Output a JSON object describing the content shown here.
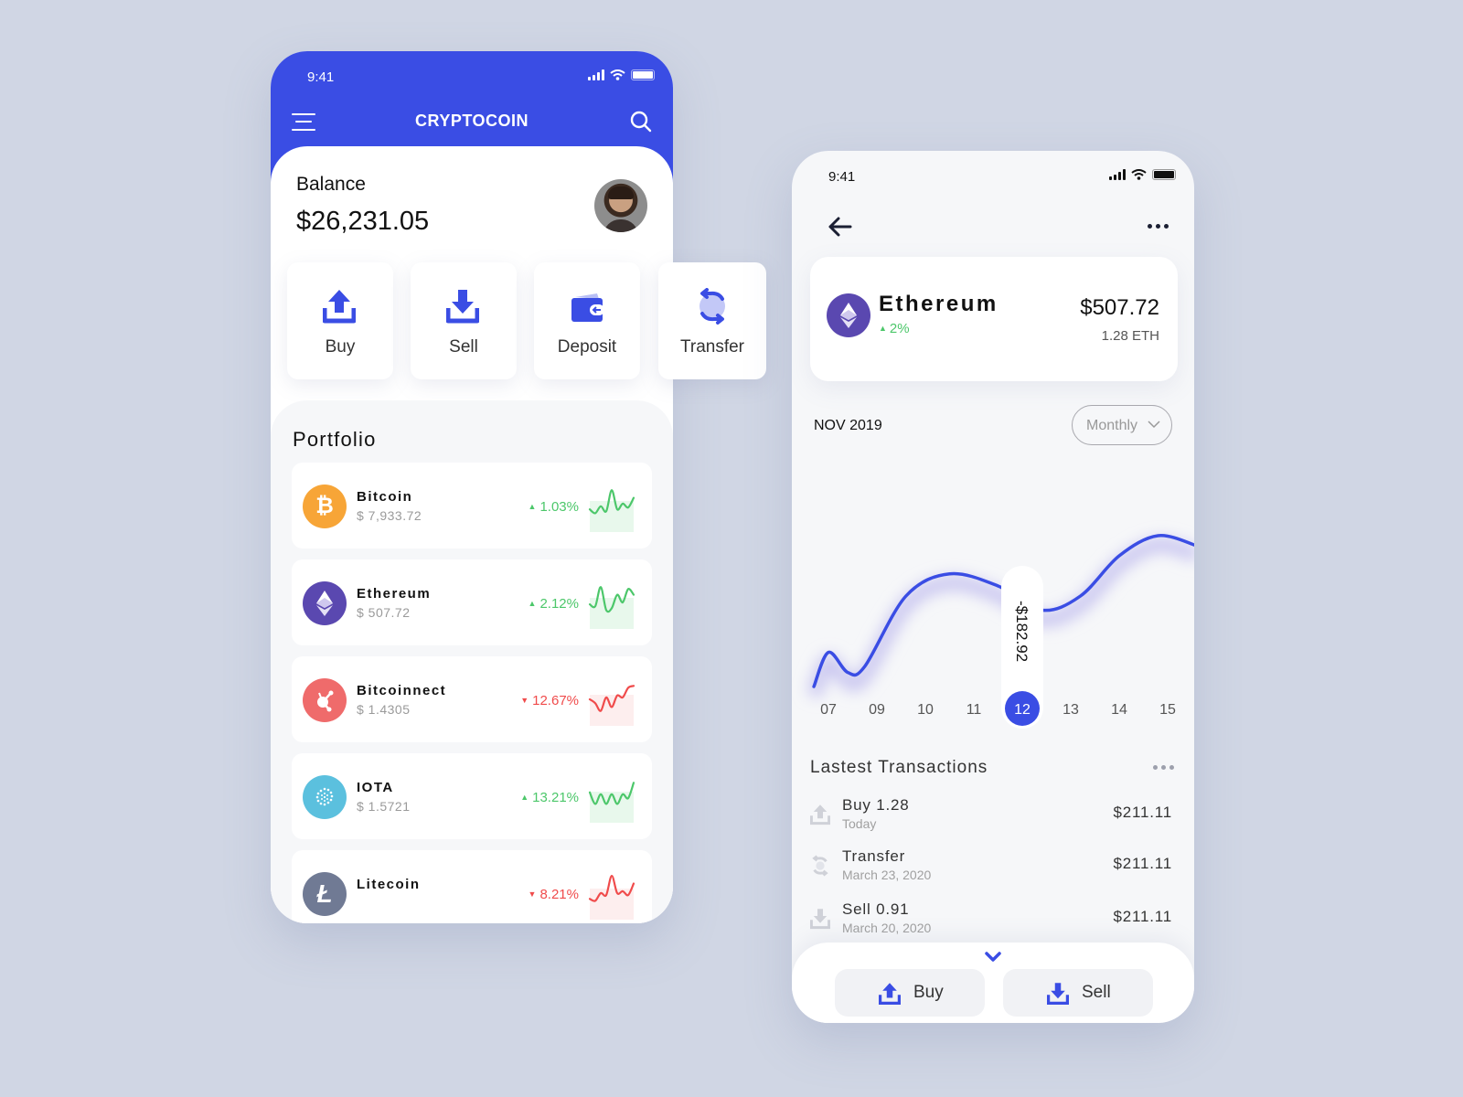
{
  "colors": {
    "brand": "#3a4de4",
    "positive": "#4cc76a",
    "negative": "#f04b4b",
    "background": "#d0d6e4"
  },
  "left_screen": {
    "status_bar": {
      "time": "9:41",
      "icons": [
        "signal-icon",
        "wifi-icon",
        "battery-icon"
      ]
    },
    "header": {
      "title": "CRYPTOCOIN",
      "left_icon": "menu-icon",
      "right_icon": "search-icon"
    },
    "balance": {
      "label": "Balance",
      "value": "$26,231.05"
    },
    "actions": [
      {
        "label": "Buy",
        "icon": "upload-icon"
      },
      {
        "label": "Sell",
        "icon": "download-icon"
      },
      {
        "label": "Deposit",
        "icon": "wallet-icon"
      },
      {
        "label": "Transfer",
        "icon": "transfer-icon"
      }
    ],
    "portfolio": {
      "title": "Portfolio",
      "coins": [
        {
          "name": "Bitcoin",
          "price": "$ 7,933.72",
          "change": "1.03%",
          "direction": "up",
          "icon": "bitcoin-icon",
          "icon_color": "#f7a537",
          "spark": [
            40,
            30,
            48,
            35,
            90,
            40,
            55,
            45,
            70
          ]
        },
        {
          "name": "Ethereum",
          "price": "$ 507.72",
          "change": "2.12%",
          "direction": "up",
          "icon": "ethereum-icon",
          "icon_color": "#5a48b0",
          "spark": [
            45,
            40,
            90,
            30,
            35,
            70,
            50,
            85,
            70
          ]
        },
        {
          "name": "Bitcoinnect",
          "price": "$ 1.4305",
          "change": "12.67%",
          "direction": "down",
          "icon": "bitconnect-icon",
          "icon_color": "#ef6b6b",
          "spark": [
            50,
            40,
            20,
            55,
            30,
            60,
            55,
            80,
            85
          ]
        },
        {
          "name": "IOTA",
          "price": "$ 1.5721",
          "change": "13.21%",
          "direction": "up",
          "icon": "iota-icon",
          "icon_color": "#5bc0de",
          "spark": [
            60,
            30,
            55,
            30,
            55,
            30,
            55,
            45,
            85
          ]
        },
        {
          "name": "Litecoin",
          "price": "",
          "change": "8.21%",
          "direction": "down",
          "icon": "litecoin-icon",
          "icon_color": "#707a94",
          "spark": [
            35,
            30,
            50,
            45,
            95,
            50,
            55,
            45,
            75
          ]
        }
      ]
    }
  },
  "right_screen": {
    "status_bar": {
      "time": "9:41",
      "icons": [
        "signal-icon",
        "wifi-icon",
        "battery-icon"
      ]
    },
    "nav": {
      "left_icon": "back-arrow-icon",
      "right_icon": "more-icon"
    },
    "coin": {
      "name": "Ethereum",
      "change": "2%",
      "direction": "up",
      "price": "$507.72",
      "amount": "1.28 ETH",
      "icon": "ethereum-icon"
    },
    "period": "NOV 2019",
    "filter": {
      "selected": "Monthly"
    },
    "tooltip": {
      "value": "-$182.92"
    },
    "transactions": {
      "title": "Lastest Transactions",
      "items": [
        {
          "title": "Buy 1.28",
          "subtitle": "Today",
          "amount": "$211.11",
          "icon": "upload-icon"
        },
        {
          "title": "Transfer",
          "subtitle": "March 23, 2020",
          "amount": "$211.11",
          "icon": "transfer-icon"
        },
        {
          "title": "Sell 0.91",
          "subtitle": "March 20, 2020",
          "amount": "$211.11",
          "icon": "download-icon"
        }
      ]
    },
    "bottom_actions": [
      {
        "label": "Buy",
        "icon": "upload-icon"
      },
      {
        "label": "Sell",
        "icon": "download-icon"
      }
    ]
  },
  "chart_data": {
    "type": "line",
    "title": "NOV 2019",
    "xlabel": "",
    "ylabel": "",
    "categories": [
      "07",
      "09",
      "10",
      "11",
      "12",
      "13",
      "14",
      "15"
    ],
    "selected_category": "12",
    "selected_label": "-$182.92",
    "series": [
      {
        "name": "Ethereum",
        "x": [
          6.4,
          7.0,
          7.8,
          8.5,
          9.6,
          10.5,
          11.5,
          12.4,
          13.2,
          14.0,
          14.8,
          15.6
        ],
        "values": [
          20,
          37,
          27,
          30,
          65,
          76,
          70,
          58,
          65,
          85,
          95,
          90
        ]
      }
    ],
    "ylim": [
      0,
      100
    ],
    "grid": false,
    "legend": "none"
  }
}
